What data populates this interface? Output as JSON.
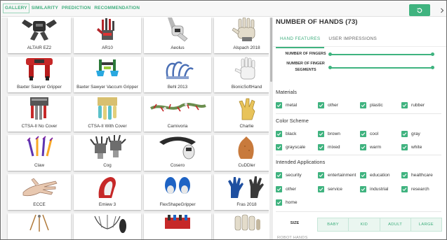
{
  "nav": {
    "tabs": [
      "GALLERY",
      "SIMILARITY",
      "PREDICTION",
      "RECOMMENDATION"
    ],
    "active_tab": "GALLERY",
    "reset_icon": "refresh-icon",
    "more_icon": "chevron-right-icon"
  },
  "gallery": {
    "items": [
      {
        "label": "ALTAIR EZ2"
      },
      {
        "label": "AR10"
      },
      {
        "label": "Aeolus"
      },
      {
        "label": "Alspach 2018"
      },
      {
        "label": "Baxter Sawyer Gripper"
      },
      {
        "label": "Baxter Sawyer Vaccum Gripper"
      },
      {
        "label": "Behl 2013"
      },
      {
        "label": "BionicSoftHand"
      },
      {
        "label": "CTSA-II No Cover"
      },
      {
        "label": "CTSA-II With Cover"
      },
      {
        "label": "Carnivoria"
      },
      {
        "label": "Charlie"
      },
      {
        "label": "Claw"
      },
      {
        "label": "Cog"
      },
      {
        "label": "Cosero"
      },
      {
        "label": "CuDDler"
      },
      {
        "label": "ECCE"
      },
      {
        "label": "Emiew 3"
      },
      {
        "label": "FlexShapeGripper"
      },
      {
        "label": "Fras 2018"
      },
      {
        "label": ""
      },
      {
        "label": ""
      },
      {
        "label": ""
      },
      {
        "label": ""
      }
    ]
  },
  "panel": {
    "title": "NUMBER OF HANDS (73)",
    "tabs": [
      "HAND FEATURES",
      "USER IMPRESSIONS"
    ],
    "active_tab": "HAND FEATURES",
    "sliders": [
      {
        "label": "NUMBER OF FINGERS",
        "min_pos": 0,
        "max_pos": 1
      },
      {
        "label": "NUMBER OF FINGER SEGMENTS",
        "min_pos": 0,
        "max_pos": 1
      }
    ],
    "materials": {
      "heading": "Materials",
      "options": [
        "metal",
        "other",
        "plastic",
        "rubber"
      ]
    },
    "color_scheme": {
      "heading": "Color Scheme",
      "options": [
        "black",
        "brown",
        "cool",
        "gray",
        "grayscale",
        "mixed",
        "warm",
        "white"
      ]
    },
    "applications": {
      "heading": "Intended Applications",
      "options": [
        "security",
        "entertainment",
        "education",
        "healthcare",
        "other",
        "service",
        "industrial",
        "research",
        "home"
      ]
    },
    "size": {
      "label": "SIZE",
      "options": [
        "BABY",
        "KID",
        "ADULT",
        "LARGE"
      ]
    },
    "cutoff_text": "ROBOT HANDS"
  },
  "colors": {
    "accent": "#3fb37f",
    "accent_text": "#3fae7d"
  }
}
